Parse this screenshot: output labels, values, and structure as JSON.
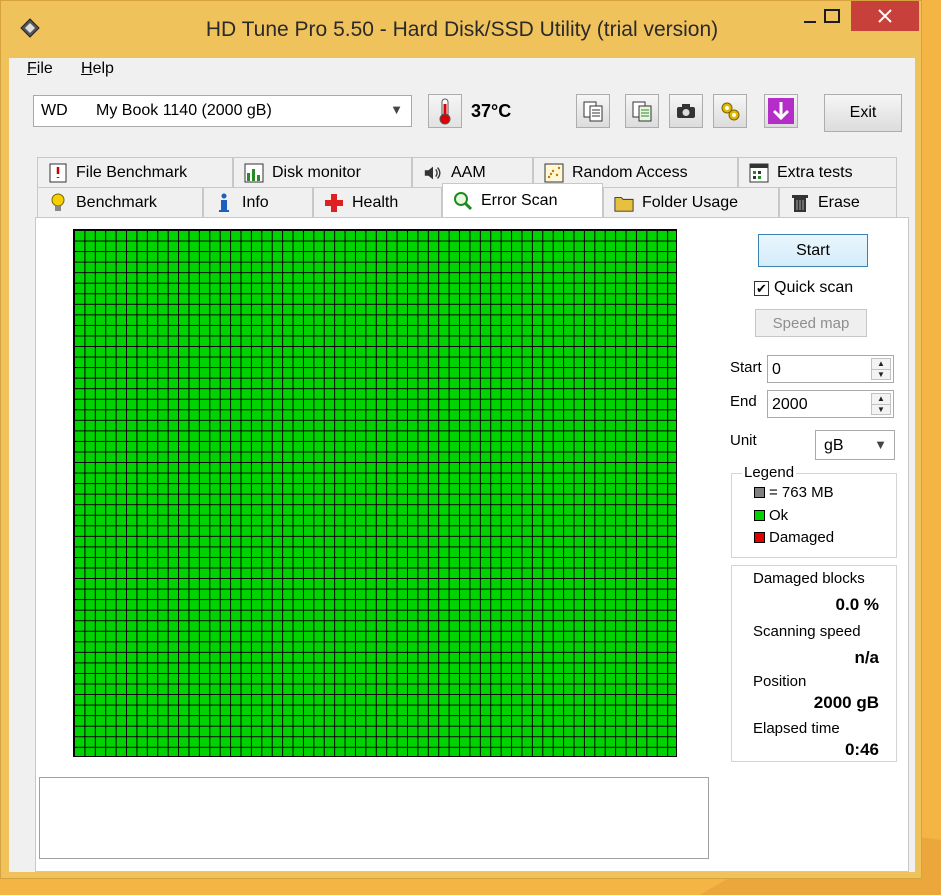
{
  "window": {
    "title": "HD Tune Pro 5.50 - Hard Disk/SSD Utility (trial version)",
    "controls": {
      "minimize": "—",
      "maximize": "☐",
      "close": "✕"
    }
  },
  "menu": {
    "file_prefix": "F",
    "file_rest": "ile",
    "help_prefix": "H",
    "help_rest": "elp"
  },
  "toolbar": {
    "drive_brand": "WD",
    "drive_name": "My Book 1140 (2000 gB)",
    "temperature": "37°C",
    "exit_label": "Exit",
    "icon_names": [
      "copy-info-icon",
      "copy-all-icon",
      "screenshot-icon",
      "options-icon",
      "download-icon"
    ]
  },
  "tabs": {
    "row_top": [
      {
        "label": "File Benchmark",
        "icon": "file-benchmark-icon"
      },
      {
        "label": "Disk monitor",
        "icon": "disk-monitor-icon"
      },
      {
        "label": "AAM",
        "icon": "speaker-icon"
      },
      {
        "label": "Random Access",
        "icon": "random-access-icon"
      },
      {
        "label": "Extra tests",
        "icon": "extra-tests-icon"
      }
    ],
    "row_bottom": [
      {
        "label": "Benchmark",
        "icon": "lightbulb-icon"
      },
      {
        "label": "Info",
        "icon": "info-icon"
      },
      {
        "label": "Health",
        "icon": "health-cross-icon"
      },
      {
        "label": "Error Scan",
        "icon": "magnifier-icon",
        "active": true
      },
      {
        "label": "Folder Usage",
        "icon": "folder-icon"
      },
      {
        "label": "Erase",
        "icon": "trash-icon"
      }
    ]
  },
  "scan": {
    "start_label": "Start",
    "quick_scan_label": "Quick scan",
    "quick_scan_checked": true,
    "speed_map_label": "Speed map",
    "start_field_label": "Start",
    "start_value": "0",
    "end_field_label": "End",
    "end_value": "2000",
    "unit_label": "Unit",
    "unit_value": "gB",
    "grid_color": "#00d400"
  },
  "legend": {
    "title": "Legend",
    "items": [
      {
        "label": "= 763 MB",
        "color": "#808080"
      },
      {
        "label": "Ok",
        "color": "#00d400"
      },
      {
        "label": "Damaged",
        "color": "#e00000"
      }
    ]
  },
  "stats": {
    "damaged_blocks_label": "Damaged blocks",
    "damaged_blocks_value": "0.0 %",
    "scanning_speed_label": "Scanning speed",
    "scanning_speed_value": "n/a",
    "position_label": "Position",
    "position_value": "2000 gB",
    "elapsed_label": "Elapsed time",
    "elapsed_value": "0:46"
  }
}
